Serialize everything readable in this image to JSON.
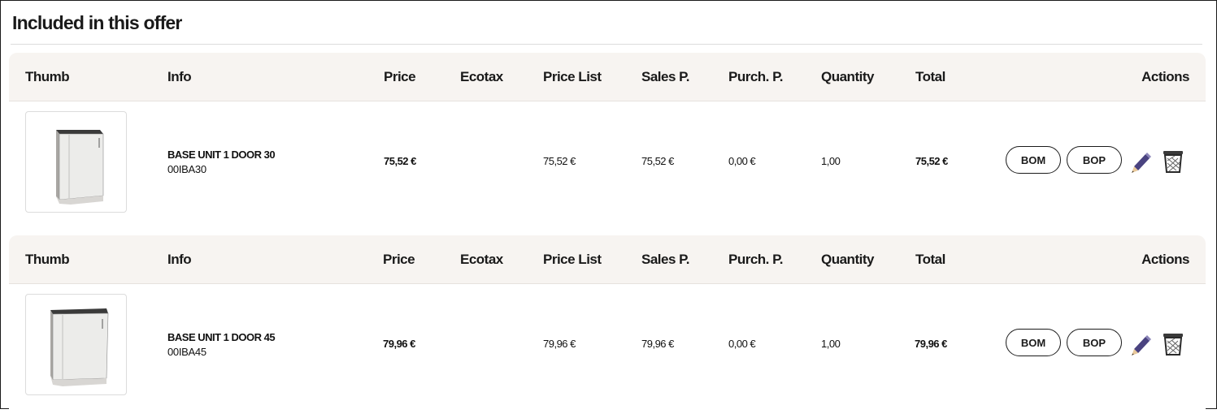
{
  "page": {
    "title": "Included in this offer"
  },
  "columns": {
    "thumb": "Thumb",
    "info": "Info",
    "price": "Price",
    "ecotax": "Ecotax",
    "price_list": "Price List",
    "sales_p": "Sales P.",
    "purch_p": "Purch. P.",
    "quantity": "Quantity",
    "total": "Total",
    "actions": "Actions"
  },
  "items": [
    {
      "name": "BASE UNIT 1 DOOR 30",
      "code": "00IBA30",
      "price": "75,52 €",
      "ecotax": "",
      "price_list": "75,52 €",
      "sales_p": "75,52 €",
      "purch_p": "0,00 €",
      "quantity": "1,00",
      "total": "75,52 €",
      "bom_label": "BOM",
      "bop_label": "BOP"
    },
    {
      "name": "BASE UNIT 1 DOOR 45",
      "code": "00IBA45",
      "price": "79,96 €",
      "ecotax": "",
      "price_list": "79,96 €",
      "sales_p": "79,96 €",
      "purch_p": "0,00 €",
      "quantity": "1,00",
      "total": "79,96 €",
      "bom_label": "BOM",
      "bop_label": "BOP"
    }
  ],
  "icons": {
    "edit": "pencil-icon",
    "delete": "trash-bin-icon"
  },
  "colors": {
    "header_bg": "#f7f4f1",
    "text": "#1a1a1a",
    "pencil": "#4a4380",
    "border": "#dcdcdc"
  }
}
